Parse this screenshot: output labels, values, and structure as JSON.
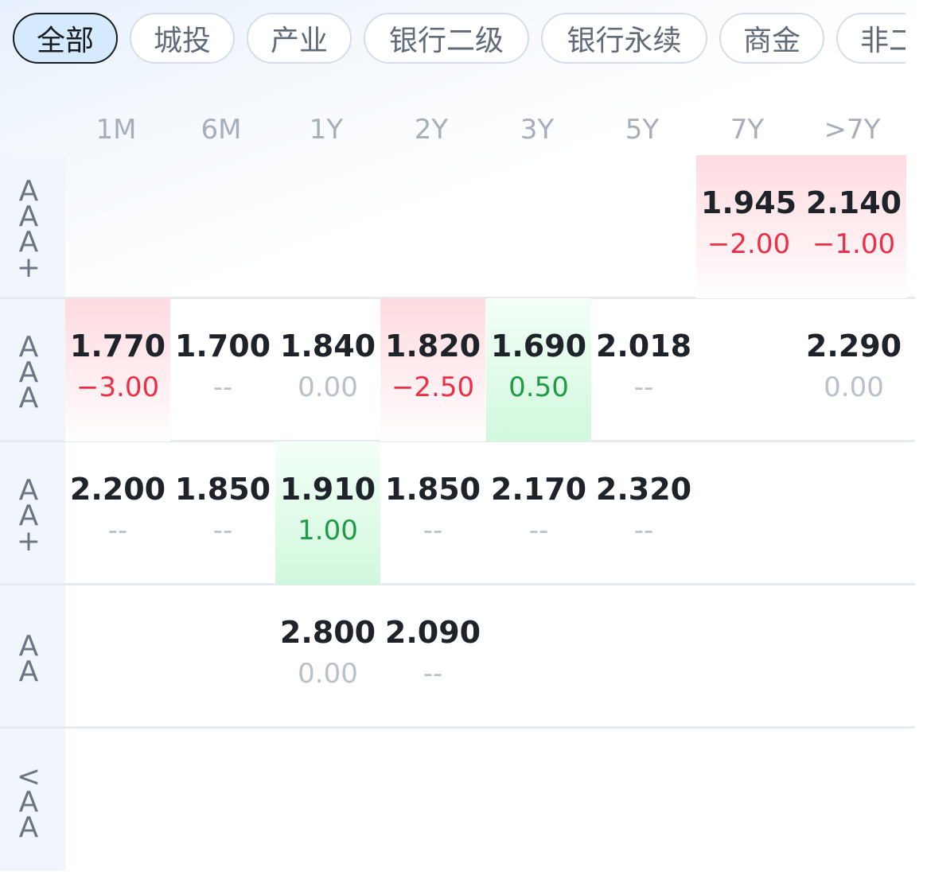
{
  "filters": [
    {
      "label": "全部",
      "active": true
    },
    {
      "label": "城投"
    },
    {
      "label": "产业"
    },
    {
      "label": "银行二级"
    },
    {
      "label": "银行永续"
    },
    {
      "label": "商金"
    },
    {
      "label": "非二"
    }
  ],
  "columns": [
    "1M",
    "6M",
    "1Y",
    "2Y",
    "3Y",
    "5Y",
    "7Y",
    ">7Y"
  ],
  "rows": [
    {
      "label": [
        "A",
        "A",
        "A",
        "+"
      ],
      "cells": [
        null,
        null,
        null,
        null,
        null,
        null,
        {
          "value": "1.945",
          "change": "-2.00",
          "trend": "neg"
        },
        {
          "value": "2.140",
          "change": "-1.00",
          "trend": "neg"
        }
      ]
    },
    {
      "label": [
        "A",
        "A",
        "A"
      ],
      "cells": [
        {
          "value": "1.770",
          "change": "-3.00",
          "trend": "neg"
        },
        {
          "value": "1.700",
          "change": "--",
          "trend": "neutral"
        },
        {
          "value": "1.840",
          "change": "0.00",
          "trend": "neutral"
        },
        {
          "value": "1.820",
          "change": "-2.50",
          "trend": "neg"
        },
        {
          "value": "1.690",
          "change": "0.50",
          "trend": "pos"
        },
        {
          "value": "2.018",
          "change": "--",
          "trend": "neutral"
        },
        null,
        {
          "value": "2.290",
          "change": "0.00",
          "trend": "neutral"
        }
      ]
    },
    {
      "label": [
        "A",
        "A",
        "+"
      ],
      "cells": [
        {
          "value": "2.200",
          "change": "--",
          "trend": "neutral"
        },
        {
          "value": "1.850",
          "change": "--",
          "trend": "neutral"
        },
        {
          "value": "1.910",
          "change": "1.00",
          "trend": "pos"
        },
        {
          "value": "1.850",
          "change": "--",
          "trend": "neutral"
        },
        {
          "value": "2.170",
          "change": "--",
          "trend": "neutral"
        },
        {
          "value": "2.320",
          "change": "--",
          "trend": "neutral"
        },
        null,
        null
      ]
    },
    {
      "label": [
        "A",
        "A"
      ],
      "cells": [
        null,
        null,
        {
          "value": "2.800",
          "change": "0.00",
          "trend": "neutral"
        },
        {
          "value": "2.090",
          "change": "--",
          "trend": "neutral"
        },
        null,
        null,
        null,
        null
      ]
    },
    {
      "label": [
        "<",
        "A",
        "A"
      ],
      "cells": [
        null,
        null,
        null,
        null,
        null,
        null,
        null,
        null
      ]
    }
  ],
  "colors": {
    "negative": "#ec2e47",
    "positive": "#1f9a45",
    "neutral": "#b8c0c9",
    "active_chip": "#d6eafd"
  }
}
